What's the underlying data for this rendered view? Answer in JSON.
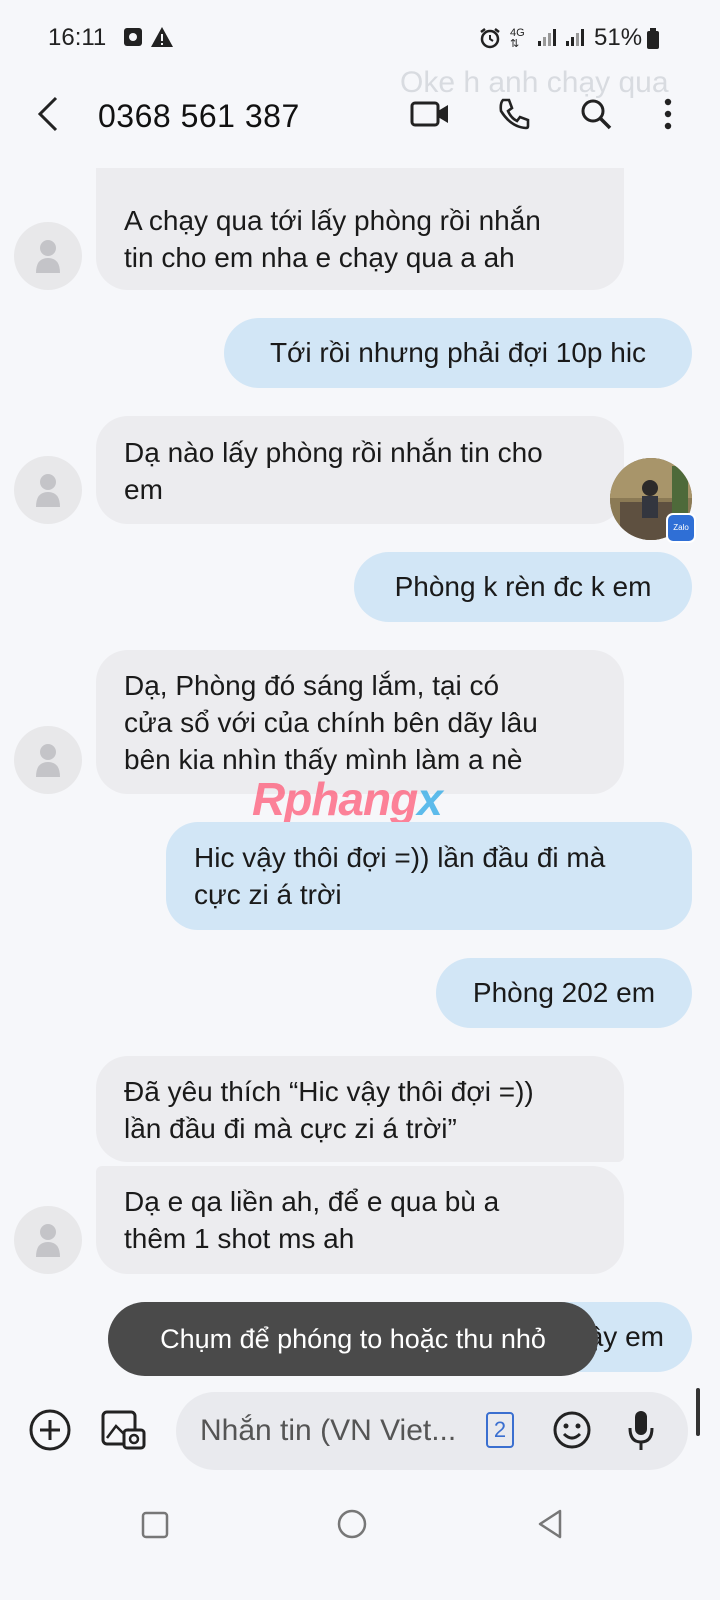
{
  "status_bar": {
    "time": "16:11",
    "battery": "51%"
  },
  "header": {
    "ghost_text": "Oke h anh chạy qua",
    "contact": "0368 561 387"
  },
  "messages": [
    {
      "dir": "in",
      "text": "A chạy qua tới lấy phòng rồi nhắn\ntin cho em nha e chạy qua a ah"
    },
    {
      "dir": "out",
      "text": "Tới rồi nhưng phải đợi 10p hic"
    },
    {
      "dir": "in",
      "text": "Dạ nào lấy phòng rồi nhắn tin cho\nem"
    },
    {
      "dir": "out",
      "text": "Phòng k rèn đc k em"
    },
    {
      "dir": "in",
      "text": "Dạ, Phòng đó sáng lắm, tại có\ncửa sổ với của chính bên dãy lâu\nbên kia nhìn thấy mình làm a nè"
    },
    {
      "dir": "out",
      "text": "Hic vậy thôi đợi =)) lần đầu đi mà\ncực zi á trời"
    },
    {
      "dir": "out",
      "text": "Phòng 202 em"
    },
    {
      "dir": "in",
      "text": "Đã yêu thích “Hic vậy thôi đợi =))\nlần đầu đi mà cực zi á trời”"
    },
    {
      "dir": "in",
      "text": "Dạ e qa liền ah, để e qua bù a\nthêm 1 shot ms ah"
    },
    {
      "dir": "out",
      "text": "Ừ vậy em"
    }
  ],
  "floating_badge": "Zalo",
  "watermark": {
    "main": "Rphang",
    "end": "x"
  },
  "toast": "Chụm để phóng to hoặc thu nhỏ",
  "composer": {
    "placeholder": "Nhắn tin (VN Viet...",
    "sim_badge": "2"
  },
  "colors": {
    "incoming_bubble": "#ececef",
    "outgoing_bubble": "#d2e6f6",
    "background": "#f6f7fa"
  },
  "icons": [
    "back-icon",
    "video-call-icon",
    "phone-icon",
    "search-icon",
    "more-icon",
    "add-icon",
    "gallery-icon",
    "emoji-icon",
    "mic-icon",
    "recents-icon",
    "home-icon",
    "back-nav-icon"
  ]
}
